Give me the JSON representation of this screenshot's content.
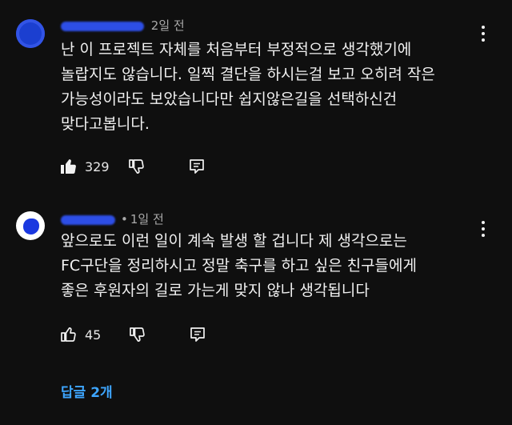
{
  "comments": [
    {
      "time": "2일 전",
      "text_lines": [
        "난 이 프로젝트 자체를 처음부터 부정적으로 생각했기에",
        "놀랍지도 않습니다.  일찍 결단을 하시는걸 보고 오히려 작은",
        "가능성이라도 보았습니다만  쉽지않은길을 선택하신건",
        "맞다고봅니다."
      ],
      "like_count": "329",
      "avatar_color": "#1b3fd0",
      "icons": {
        "like": "thumb-up-filled-icon",
        "dislike": "thumb-down-icon",
        "reply": "reply-icon",
        "more": "more-vert-icon"
      }
    },
    {
      "time_prefix": "•",
      "time": "1일 전",
      "text_lines": [
        "앞으로도 이런 일이 계속 발생 할 겁니다 제 생각으로는",
        "FC구단을 정리하시고 정말 축구를 하고 싶은 친구들에게",
        "좋은 후원자의 길로 가는게 맞지 않나 생각됩니다"
      ],
      "like_count": "45",
      "avatar_color": "#ffffff",
      "icons": {
        "like": "thumb-up-icon",
        "dislike": "thumb-down-icon",
        "reply": "reply-icon",
        "more": "more-vert-icon"
      }
    }
  ],
  "replies_link": "답글 2개",
  "accent_color": "#3ea6ff"
}
